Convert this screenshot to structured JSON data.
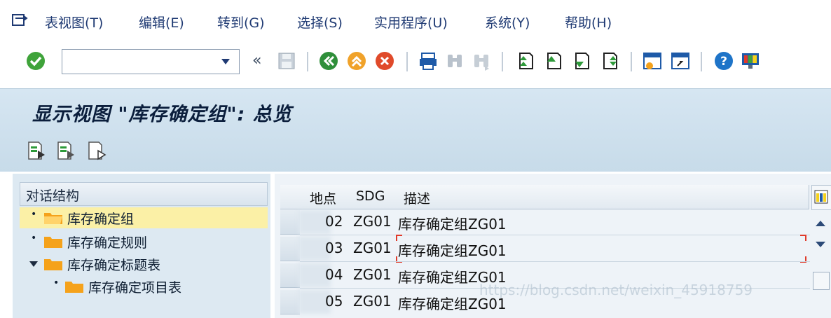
{
  "menu": {
    "items": [
      "表视图(T)",
      "编辑(E)",
      "转到(G)",
      "选择(S)",
      "实用程序(U)",
      "系统(Y)",
      "帮助(H)"
    ]
  },
  "toolbar": {
    "command_field": {
      "value": "",
      "placeholder": ""
    },
    "nav_back_glyph": "«",
    "icons": [
      "enter-icon",
      "save-icon",
      "back-icon",
      "exit-icon",
      "cancel-icon",
      "print-icon",
      "find-icon",
      "find-next-icon",
      "first-page-icon",
      "previous-page-icon",
      "next-page-icon",
      "last-page-icon",
      "create-session-icon",
      "shortcut-icon",
      "help-icon",
      "layout-icon"
    ]
  },
  "page": {
    "title": "显示视图 \"库存确定组\": 总览"
  },
  "app_toolbar": {
    "icons": [
      "change-icon",
      "detail-icon",
      "display-icon"
    ]
  },
  "dialog_structure": {
    "header": "对话结构",
    "items": [
      {
        "label": "库存确定组",
        "level": 0,
        "expanded": false,
        "selected": true
      },
      {
        "label": "库存确定规则",
        "level": 0,
        "expanded": false,
        "selected": false
      },
      {
        "label": "库存确定标题表",
        "level": 0,
        "expanded": true,
        "selected": false
      },
      {
        "label": "库存确定项目表",
        "level": 1,
        "expanded": false,
        "selected": false
      }
    ]
  },
  "table": {
    "columns": [
      "地点",
      "SDG",
      "描述"
    ],
    "rows": [
      {
        "plant": "02",
        "sdg": "ZG01",
        "desc": "库存确定组ZG01"
      },
      {
        "plant": "03",
        "sdg": "ZG01",
        "desc": "库存确定组ZG01"
      },
      {
        "plant": "04",
        "sdg": "ZG01",
        "desc": "库存确定组ZG01"
      },
      {
        "plant": "05",
        "sdg": "ZG01",
        "desc": "库存确定组ZG01"
      }
    ]
  },
  "watermark": "https://blog.csdn.net/weixin_45918759",
  "colors": {
    "menu_text": "#1f3a73",
    "title_bg": "#d6e6f2",
    "selected_tree_row": "#fbf0a6",
    "folder": "#f5a21b",
    "highlight_red": "#e03a2a"
  }
}
